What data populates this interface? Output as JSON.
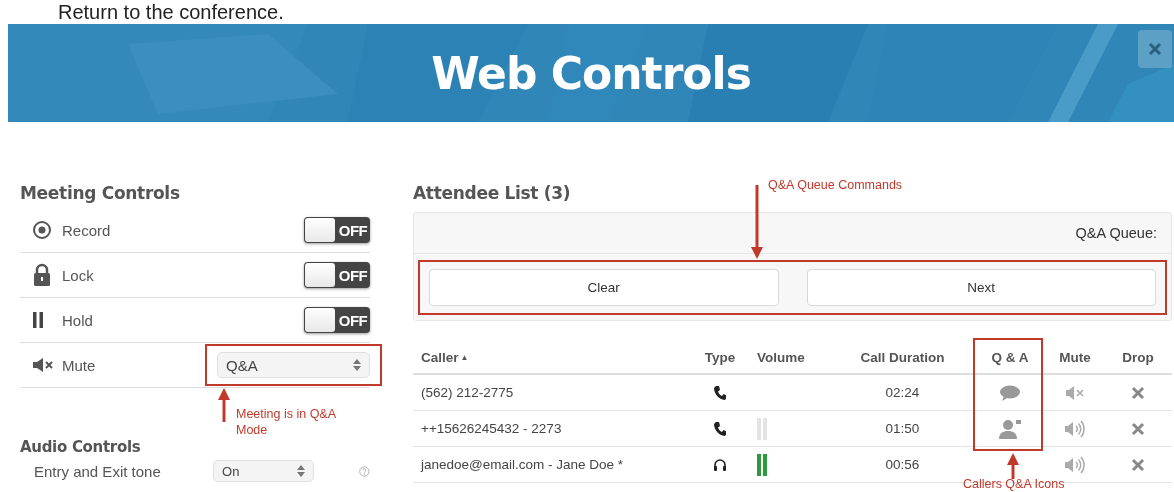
{
  "page_caption": "Return to the conference.",
  "header": {
    "title": "Web Controls"
  },
  "meeting_controls": {
    "title": "Meeting Controls",
    "items": [
      {
        "kind": "toggle",
        "label": "Record",
        "on": false,
        "state_text": "OFF"
      },
      {
        "kind": "toggle",
        "label": "Lock",
        "on": false,
        "state_text": "OFF"
      },
      {
        "kind": "toggle",
        "label": "Hold",
        "on": false,
        "state_text": "OFF"
      },
      {
        "kind": "select",
        "label": "Mute",
        "value": "Q&A",
        "highlighted": true
      }
    ]
  },
  "mute_note": "Meeting is in Q&A Mode",
  "audio_controls": {
    "title": "Audio Controls",
    "items": [
      {
        "kind": "select",
        "label": "Entry and Exit tone",
        "value": "On"
      }
    ]
  },
  "attendees": {
    "title": "Attendee List (3)",
    "queue": {
      "label": "Q&A Queue:",
      "buttons": [
        "Clear",
        "Next"
      ],
      "highlighted": true,
      "note": "Q&A Queue Commands"
    },
    "table": {
      "columns": [
        {
          "label": "Caller",
          "sort": "▲"
        },
        {
          "label": "Type"
        },
        {
          "label": "Volume"
        },
        {
          "label": "Call Duration"
        },
        {
          "label": "Q & A",
          "highlighted": true
        },
        {
          "label": "Mute"
        },
        {
          "label": "Drop"
        }
      ],
      "rows": [
        {
          "caller": "(562) 212-2775",
          "headset": false,
          "volume_shown": false,
          "duration": "02:24",
          "question": true,
          "hand_raised": false,
          "muted": true
        },
        {
          "caller": "++15626245432 - 2273",
          "headset": false,
          "volume_shown": true,
          "speaking": false,
          "duration": "01:50",
          "question": false,
          "hand_raised": true,
          "muted": false
        },
        {
          "caller": "janedoe@email.com - Jane Doe *",
          "headset": true,
          "volume_shown": true,
          "speaking": true,
          "duration": "00:56",
          "question": false,
          "hand_raised": false,
          "muted": false
        }
      ]
    },
    "qa_note": "Callers Q&A Icons"
  }
}
